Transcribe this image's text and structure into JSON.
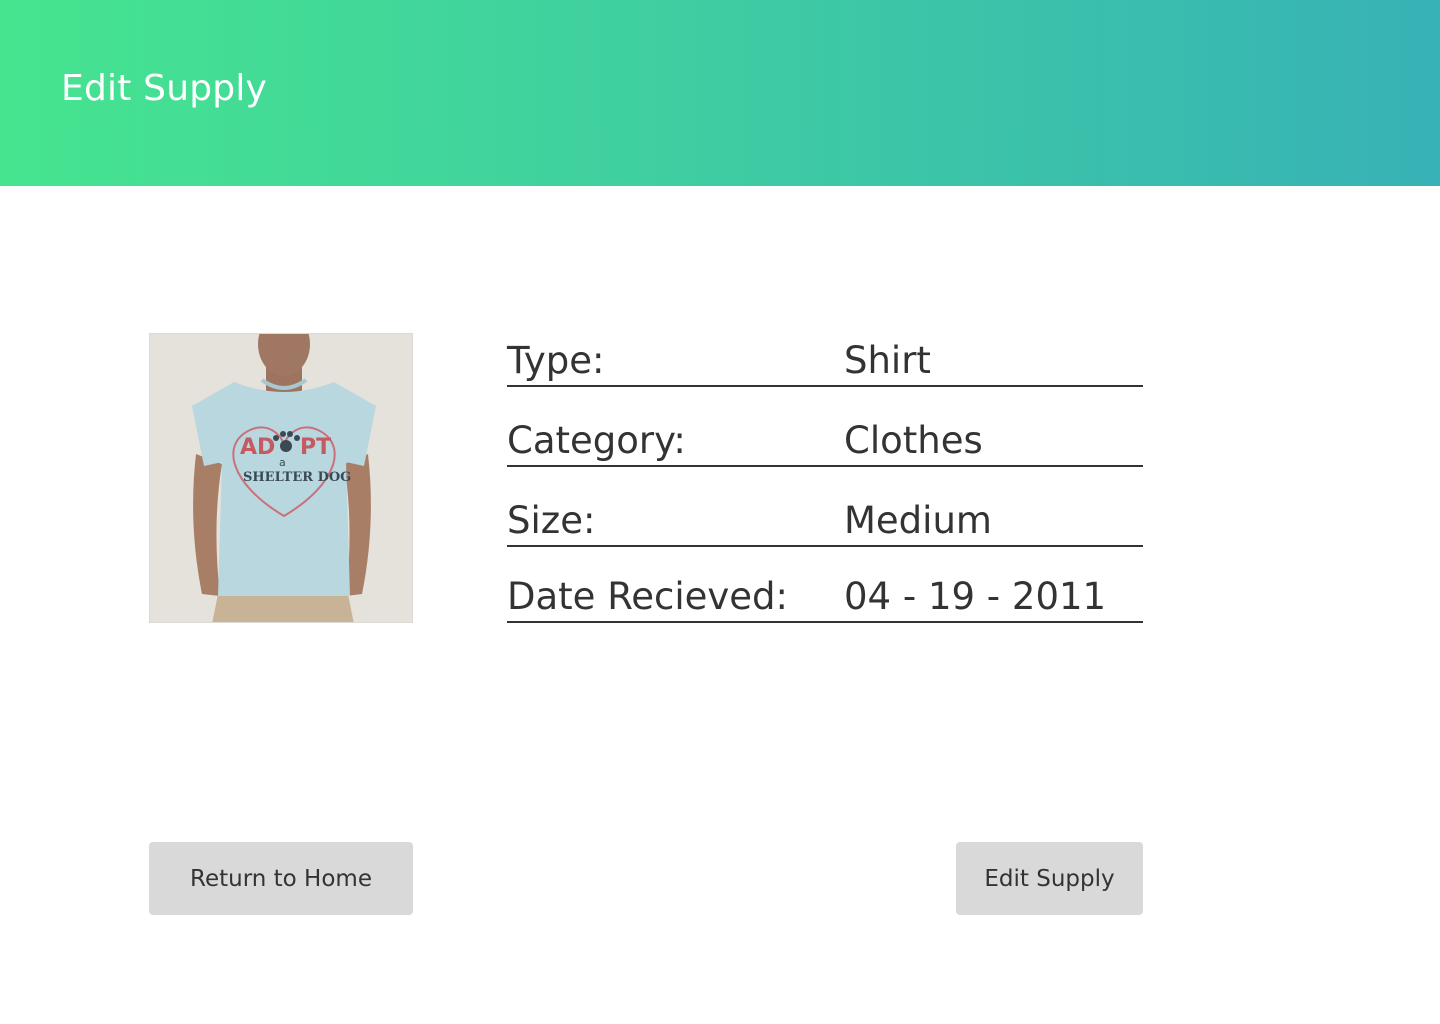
{
  "header": {
    "title": "Edit Supply"
  },
  "supply": {
    "image_alt": "ADOPT a SHELTER DOG",
    "shirt_text_line1": "AD",
    "shirt_text_line1b": "PT",
    "shirt_text_a": "a",
    "shirt_text_line2": "SHELTER DOG",
    "fields": [
      {
        "label": "Type:",
        "value": "Shirt"
      },
      {
        "label": "Category:",
        "value": "Clothes"
      },
      {
        "label": "Size:",
        "value": "Medium"
      },
      {
        "label": "Date Recieved:",
        "value": "04 - 19 - 2011"
      }
    ]
  },
  "actions": {
    "return_home_label": "Return to Home",
    "edit_supply_label": "Edit Supply"
  },
  "colors": {
    "header_gradient_start": "#46e48f",
    "header_gradient_end": "#37b2b6",
    "button_bg": "#d9d9d9",
    "text": "#333333"
  }
}
